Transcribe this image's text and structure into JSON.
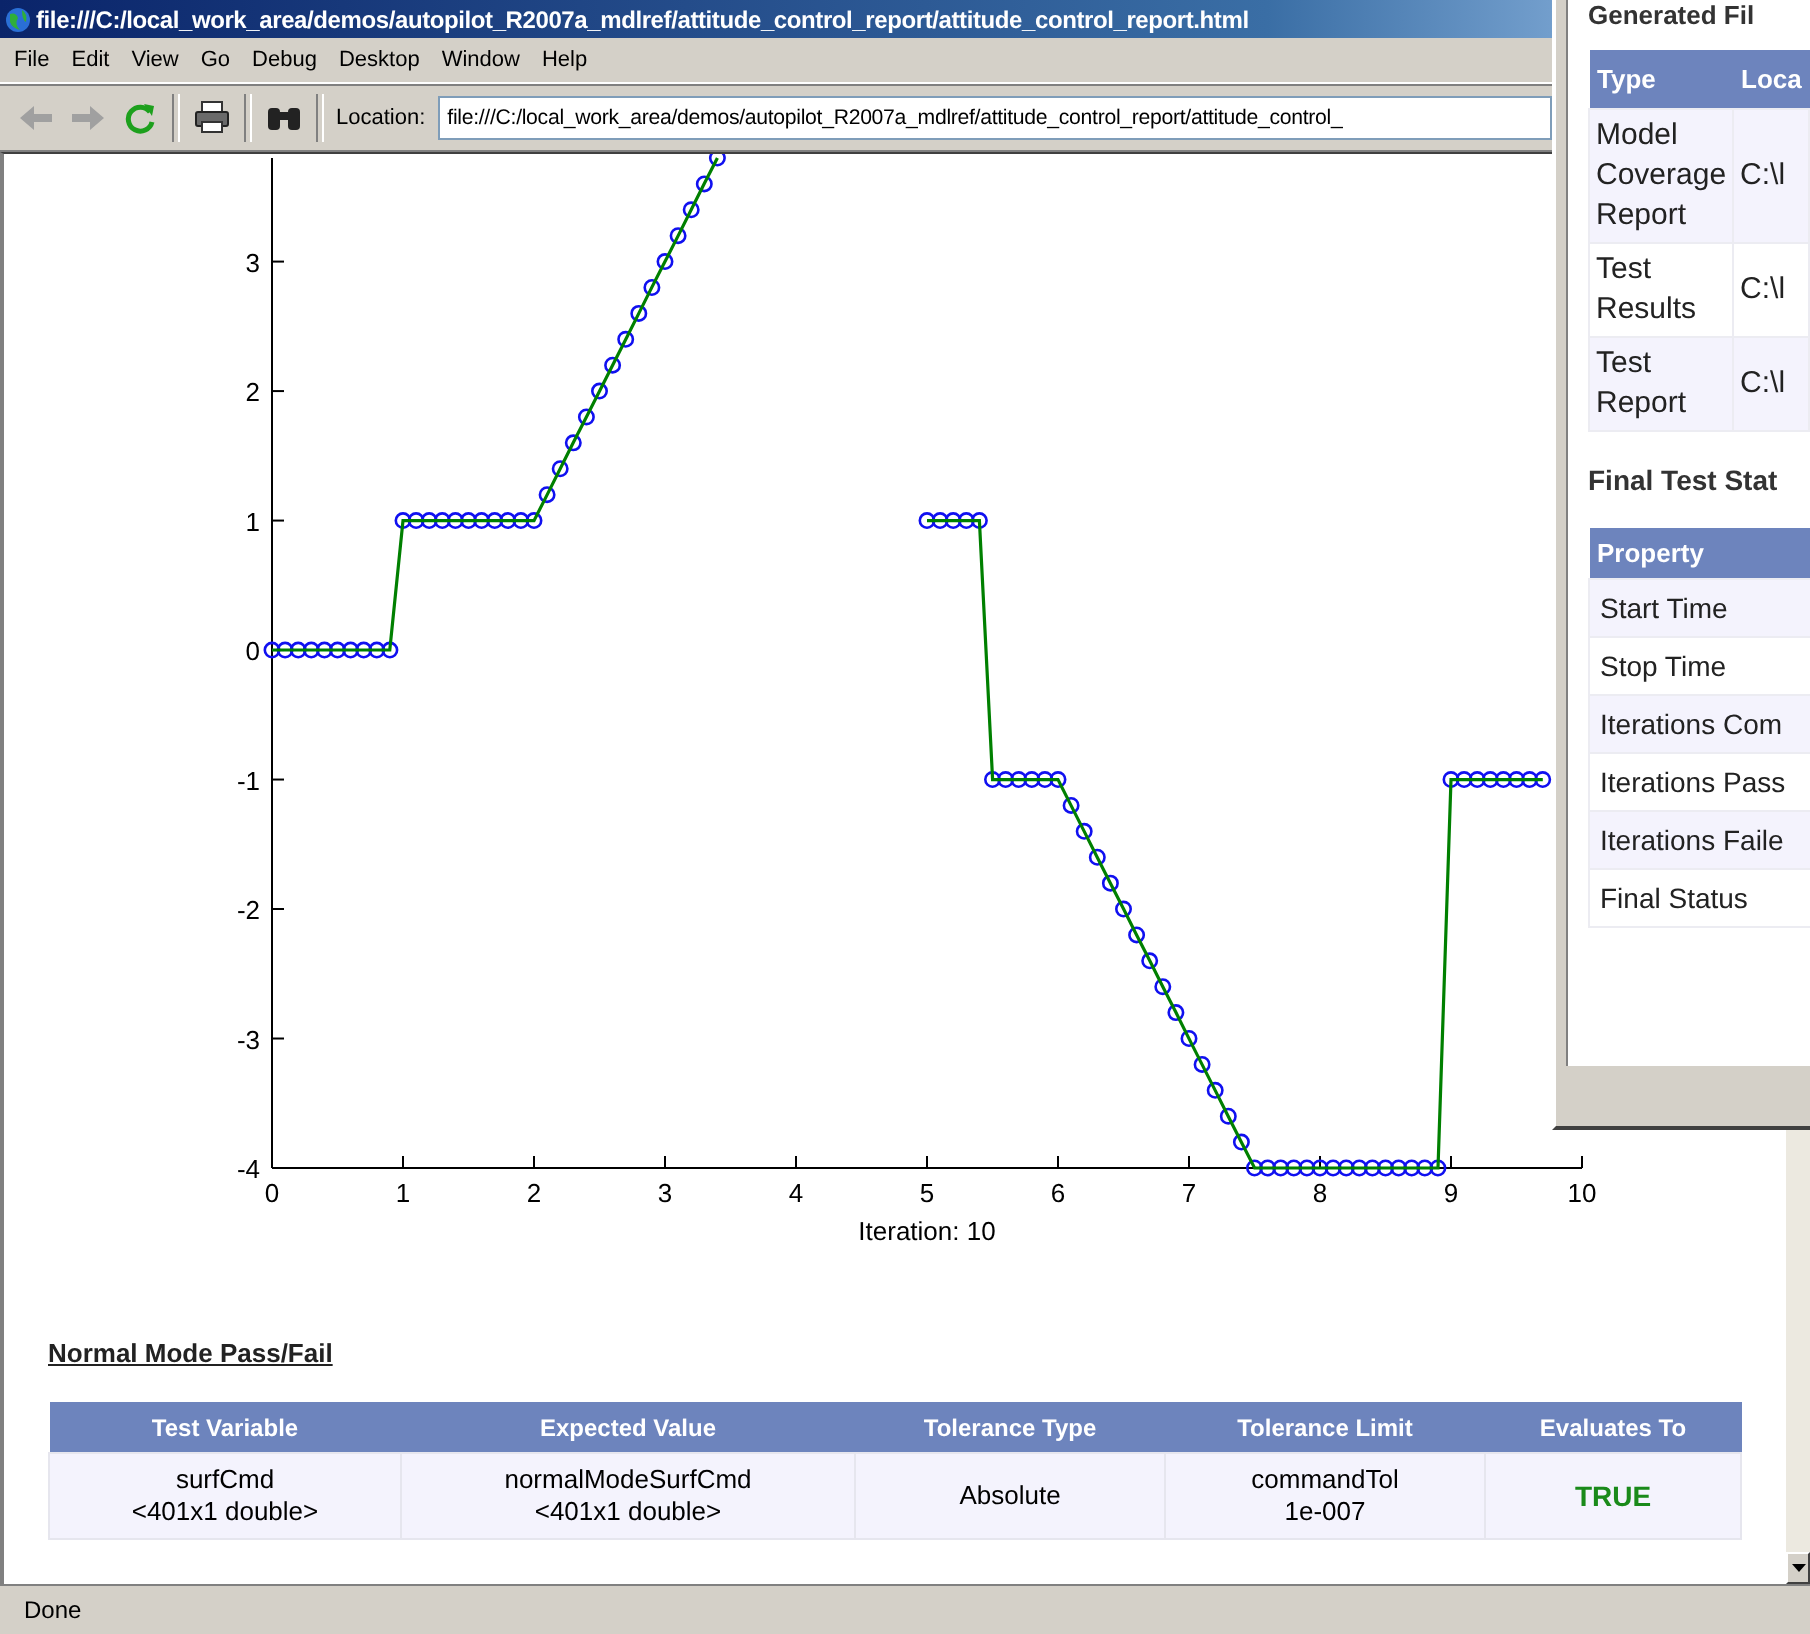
{
  "window": {
    "title": "file:///C:/local_work_area/demos/autopilot_R2007a_mdlref/attitude_control_report/attitude_control_report.html"
  },
  "menu": [
    "File",
    "Edit",
    "View",
    "Go",
    "Debug",
    "Desktop",
    "Window",
    "Help"
  ],
  "toolbar": {
    "back_disabled": true,
    "forward_disabled": true,
    "location_label": "Location:",
    "location": "file:///C:/local_work_area/demos/autopilot_R2007a_mdlref/attitude_control_report/attitude_control_"
  },
  "chart_data": {
    "type": "line",
    "xlabel": "Iteration: 10",
    "xlim": [
      0,
      10
    ],
    "ylim": [
      -4,
      3.8
    ],
    "xticks": [
      0,
      1,
      2,
      3,
      4,
      5,
      6,
      7,
      8,
      9,
      10
    ],
    "yticks": [
      -4,
      -3,
      -2,
      -1,
      0,
      1,
      2,
      3
    ],
    "x": [
      0,
      0.1,
      0.2,
      0.3,
      0.4,
      0.5,
      0.6,
      0.7,
      0.8,
      0.9,
      1,
      1.1,
      1.2,
      1.3,
      1.4,
      1.5,
      1.6,
      1.7,
      1.8,
      1.9,
      2,
      2.1,
      2.2,
      2.3,
      2.4,
      2.5,
      2.6,
      2.7,
      2.8,
      2.9,
      3,
      3.1,
      3.2,
      3.3,
      3.4,
      5,
      5.1,
      5.2,
      5.3,
      5.4,
      5.5,
      5.6,
      5.7,
      5.8,
      5.9,
      6,
      6.1,
      6.2,
      6.3,
      6.4,
      6.5,
      6.6,
      6.7,
      6.8,
      6.9,
      7,
      7.1,
      7.2,
      7.3,
      7.4,
      7.5,
      7.6,
      7.7,
      7.8,
      7.9,
      8,
      8.1,
      8.2,
      8.3,
      8.4,
      8.5,
      8.6,
      8.7,
      8.8,
      8.9,
      9,
      9.1,
      9.2,
      9.3,
      9.4,
      9.5,
      9.6,
      9.7
    ],
    "series": [
      {
        "color": "#008000",
        "marker": "o",
        "values": [
          0,
          0,
          0,
          0,
          0,
          0,
          0,
          0,
          0,
          0,
          1,
          1,
          1,
          1,
          1,
          1,
          1,
          1,
          1,
          1,
          1,
          1.2,
          1.4,
          1.6,
          1.8,
          2,
          2.2,
          2.4,
          2.6,
          2.8,
          3,
          3.2,
          3.4,
          3.6,
          3.8,
          1,
          1,
          1,
          1,
          1,
          -1,
          -1,
          -1,
          -1,
          -1,
          -1,
          -1.2,
          -1.4,
          -1.6,
          -1.8,
          -2,
          -2.2,
          -2.4,
          -2.6,
          -2.8,
          -3,
          -3.2,
          -3.4,
          -3.6,
          -3.8,
          -4,
          -4,
          -4,
          -4,
          -4,
          -4,
          -4,
          -4,
          -4,
          -4,
          -4,
          -4,
          -4,
          -4,
          -4,
          -1,
          -1,
          -1,
          -1,
          -1,
          -1,
          -1,
          -1
        ]
      }
    ]
  },
  "pass_fail": {
    "heading": "Normal Mode Pass/Fail",
    "columns": [
      "Test Variable",
      "Expected Value",
      "Tolerance Type",
      "Tolerance Limit",
      "Evaluates To"
    ],
    "rows": [
      {
        "cells": [
          [
            "surfCmd",
            "<401x1 double>"
          ],
          [
            "normalModeSurfCmd",
            "<401x1 double>"
          ],
          [
            "Absolute"
          ],
          [
            "commandTol",
            "1e-007"
          ]
        ],
        "result": "TRUE",
        "passed": true
      }
    ]
  },
  "status_bar": "Done",
  "report_window": {
    "heading": "Generated Fil",
    "files_table": {
      "columns": [
        "Type",
        "Loca"
      ],
      "rows": [
        [
          "Model Coverage Report",
          "C:\\l"
        ],
        [
          "Test Results",
          "C:\\l"
        ],
        [
          "Test Report",
          "C:\\l"
        ]
      ]
    },
    "status_heading": "Final Test Stat",
    "status_table": {
      "columns": [
        "Property"
      ],
      "rows": [
        "Start Time",
        "Stop Time",
        "Iterations Com",
        "Iterations Pass",
        "Iterations Faile",
        "Final Status"
      ]
    }
  }
}
